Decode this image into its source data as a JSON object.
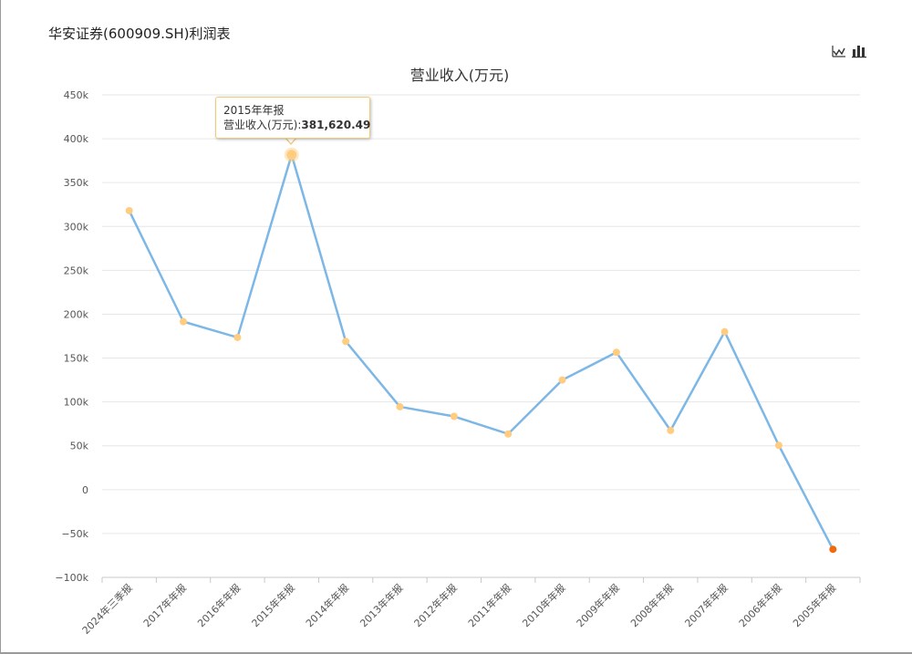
{
  "page": {
    "title": "华安证券(600909.SH)利润表"
  },
  "toolbar": {
    "line_icon": "line-chart-icon",
    "bar_icon": "bar-chart-icon"
  },
  "colors": {
    "line": "#7db7e6",
    "marker": "#ffcc80",
    "last_marker": "#f06a0c",
    "tooltip_border": "#f2c879",
    "grid": "#e6e6e6"
  },
  "tooltip": {
    "title": "2015年年报",
    "label": "营业收入(万元):",
    "value": "381,620.49"
  },
  "chart_data": {
    "type": "line",
    "title": "营业收入(万元)",
    "xlabel": "",
    "ylabel": "",
    "ylim": [
      -100000,
      450000
    ],
    "yticks": [
      -100000,
      -50000,
      0,
      50000,
      100000,
      150000,
      200000,
      250000,
      300000,
      350000,
      400000,
      450000
    ],
    "ytick_labels": [
      "−100k",
      "−50k",
      "0",
      "50k",
      "100k",
      "150k",
      "200k",
      "250k",
      "300k",
      "350k",
      "400k",
      "450k"
    ],
    "grid": true,
    "categories": [
      "2024年三季报",
      "2017年年报",
      "2016年年报",
      "2015年年报",
      "2014年年报",
      "2013年年报",
      "2012年年报",
      "2011年年报",
      "2010年年报",
      "2009年年报",
      "2008年年报",
      "2007年年报",
      "2006年年报",
      "2005年年报"
    ],
    "values": [
      318000,
      191500,
      173500,
      381620.49,
      169000,
      94500,
      83500,
      63500,
      125000,
      156500,
      67500,
      180000,
      50500,
      -68000
    ],
    "highlight_index": 3
  }
}
